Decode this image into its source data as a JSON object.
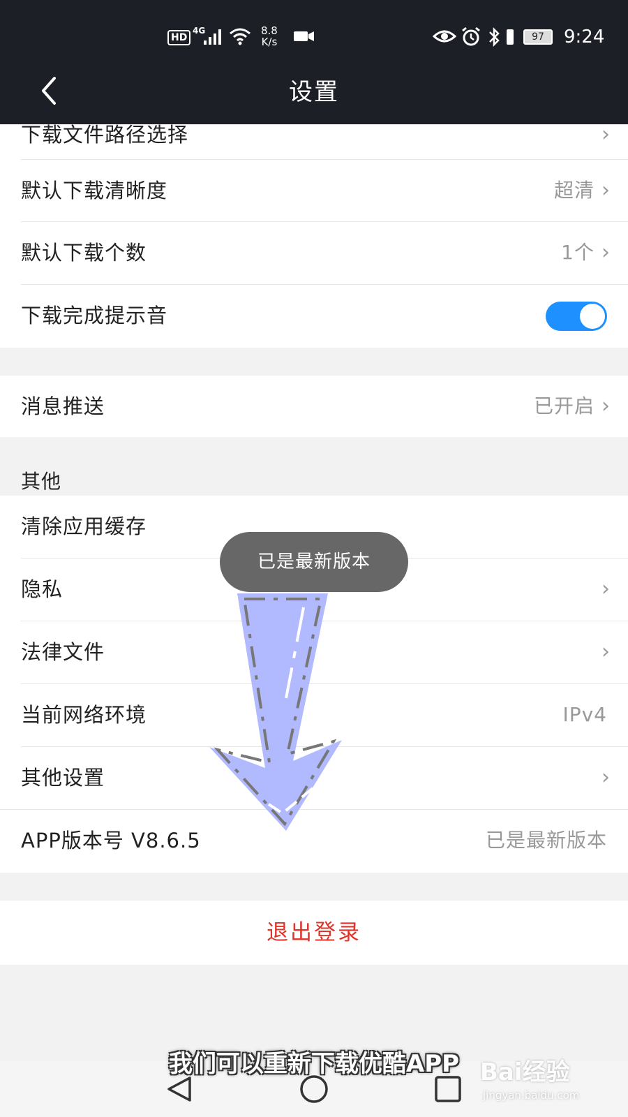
{
  "status_bar": {
    "hd": "HD",
    "network": "4G",
    "speed_top": "8.8",
    "speed_bottom": "K/s",
    "battery": "97",
    "time": "9:24",
    "icons": [
      "wifi-icon",
      "camera-icon",
      "eye-icon",
      "alarm-icon",
      "bluetooth-icon",
      "vibrate-icon"
    ]
  },
  "header": {
    "title": "设置",
    "back_icon": "chevron-left-icon"
  },
  "download_section": {
    "rows": [
      {
        "label": "下载文件路径选择",
        "value": ""
      },
      {
        "label": "默认下载清晰度",
        "value": "超清"
      },
      {
        "label": "默认下载个数",
        "value": "1个"
      },
      {
        "label": "下载完成提示音",
        "toggle": true
      }
    ]
  },
  "push_section": {
    "label": "消息推送",
    "value": "已开启"
  },
  "other_section": {
    "header": "其他",
    "rows": [
      {
        "label": "清除应用缓存",
        "value": ""
      },
      {
        "label": "隐私",
        "value": ""
      },
      {
        "label": "法律文件",
        "value": ""
      },
      {
        "label": "当前网络环境",
        "value": "IPv4"
      },
      {
        "label": "其他设置",
        "value": ""
      },
      {
        "label": "APP版本号 V8.6.5",
        "value": "已是最新版本"
      }
    ]
  },
  "logout": {
    "label": "退出登录",
    "color": "#e0342a"
  },
  "toast": {
    "text": "已是最新版本"
  },
  "caption": {
    "text": "我们可以重新下载优酷APP"
  },
  "watermark": {
    "brand": "Bai经验",
    "url": "jingyan.baidu.com"
  },
  "nav_bar": {
    "icons": [
      "back-triangle-icon",
      "home-circle-icon",
      "recent-square-icon"
    ]
  },
  "colors": {
    "topbar": "#1c1f26",
    "toggle_on": "#1e90ff",
    "accent_red": "#e0342a"
  }
}
